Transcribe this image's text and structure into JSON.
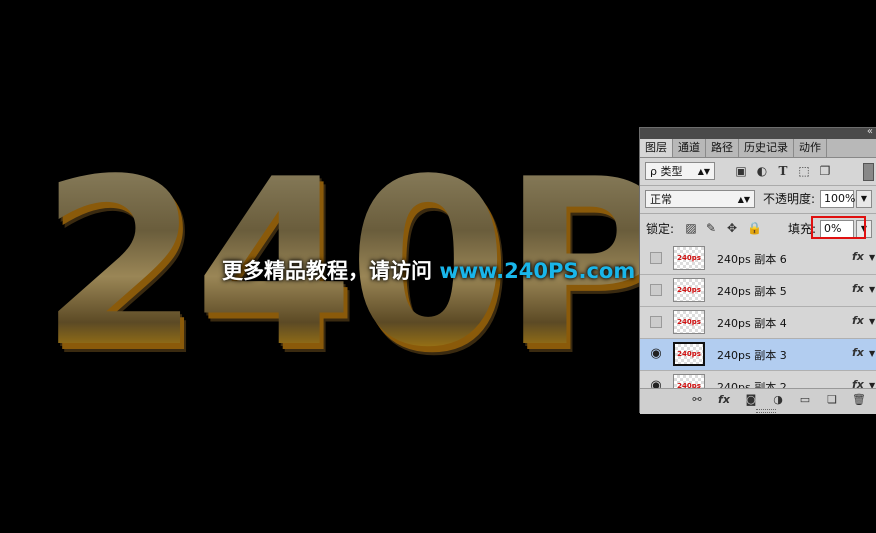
{
  "canvas": {
    "art_text": "240P",
    "watermark": {
      "prefix": "更多精品教程，请访问",
      "url": "www.240PS.com"
    },
    "colors": {
      "gold": "#e0a31a",
      "url_blue": "#19b6ea"
    }
  },
  "panel": {
    "collapse_glyph": "«",
    "tabs": [
      {
        "label": "图层"
      },
      {
        "label": "通道"
      },
      {
        "label": "路径"
      },
      {
        "label": "历史记录"
      },
      {
        "label": "动作"
      }
    ],
    "filter": {
      "label": "ρ 类型",
      "icons": [
        "image-filter-icon",
        "adjustment-filter-icon",
        "type-filter-icon",
        "shape-filter-icon",
        "smart-object-filter-icon"
      ]
    },
    "blend_mode": "正常",
    "opacity_label": "不透明度:",
    "opacity_value": "100%",
    "lock_label": "锁定:",
    "fill_label": "填充:",
    "fill_value": "0%",
    "layers": [
      {
        "name": "240ps 副本 6",
        "thumb": "240ps",
        "visible": false,
        "selected": false,
        "fx": "fx"
      },
      {
        "name": "240ps 副本 5",
        "thumb": "240ps",
        "visible": false,
        "selected": false,
        "fx": "fx"
      },
      {
        "name": "240ps 副本 4",
        "thumb": "240ps",
        "visible": false,
        "selected": false,
        "fx": "fx"
      },
      {
        "name": "240ps 副本 3",
        "thumb": "240ps",
        "visible": true,
        "selected": true,
        "fx": "fx"
      },
      {
        "name": "240ps 副本 2",
        "thumb": "240ps",
        "visible": true,
        "selected": false,
        "fx": "fx"
      }
    ],
    "selected_color": "#b2cdf0",
    "highlight_color": "#e01010"
  }
}
